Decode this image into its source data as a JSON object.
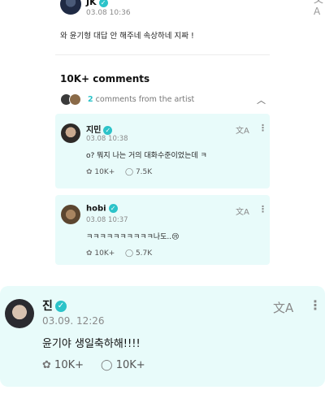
{
  "post": {
    "author": "JK",
    "time": "03.08 10:36",
    "text": "와 윤기형 대답 안 해주네 속상하네 지짜 !"
  },
  "comments_header": "10K+ comments",
  "artist_summary": {
    "count": "2",
    "label": "comments from the artist"
  },
  "icons": {
    "verified": "✓",
    "translate": "文A",
    "more": "⋮",
    "like": "✿",
    "reply": "◯",
    "chevron_up": "︿"
  },
  "comments": [
    {
      "name": "지민",
      "time": "03.08 10:38",
      "text": "o? 뭐지 나는 거의 대화수준이었는데 ㅋ",
      "likes": "10K+",
      "replies": "7.5K"
    },
    {
      "name": "hobi",
      "time": "03.08 10:37",
      "text": "ㅋㅋㅋㅋㅋㅋㅋㅋㅋㅋ나도..😢",
      "likes": "10K+",
      "replies": "5.7K"
    },
    {
      "name": "진",
      "time": "03.09. 12:26",
      "text": "윤기야 생일축하해!!!!",
      "likes": "10K+",
      "replies": "10K+"
    }
  ],
  "colors": {
    "accent": "#2cc3c9",
    "card_bg": "#e8fbfa"
  }
}
